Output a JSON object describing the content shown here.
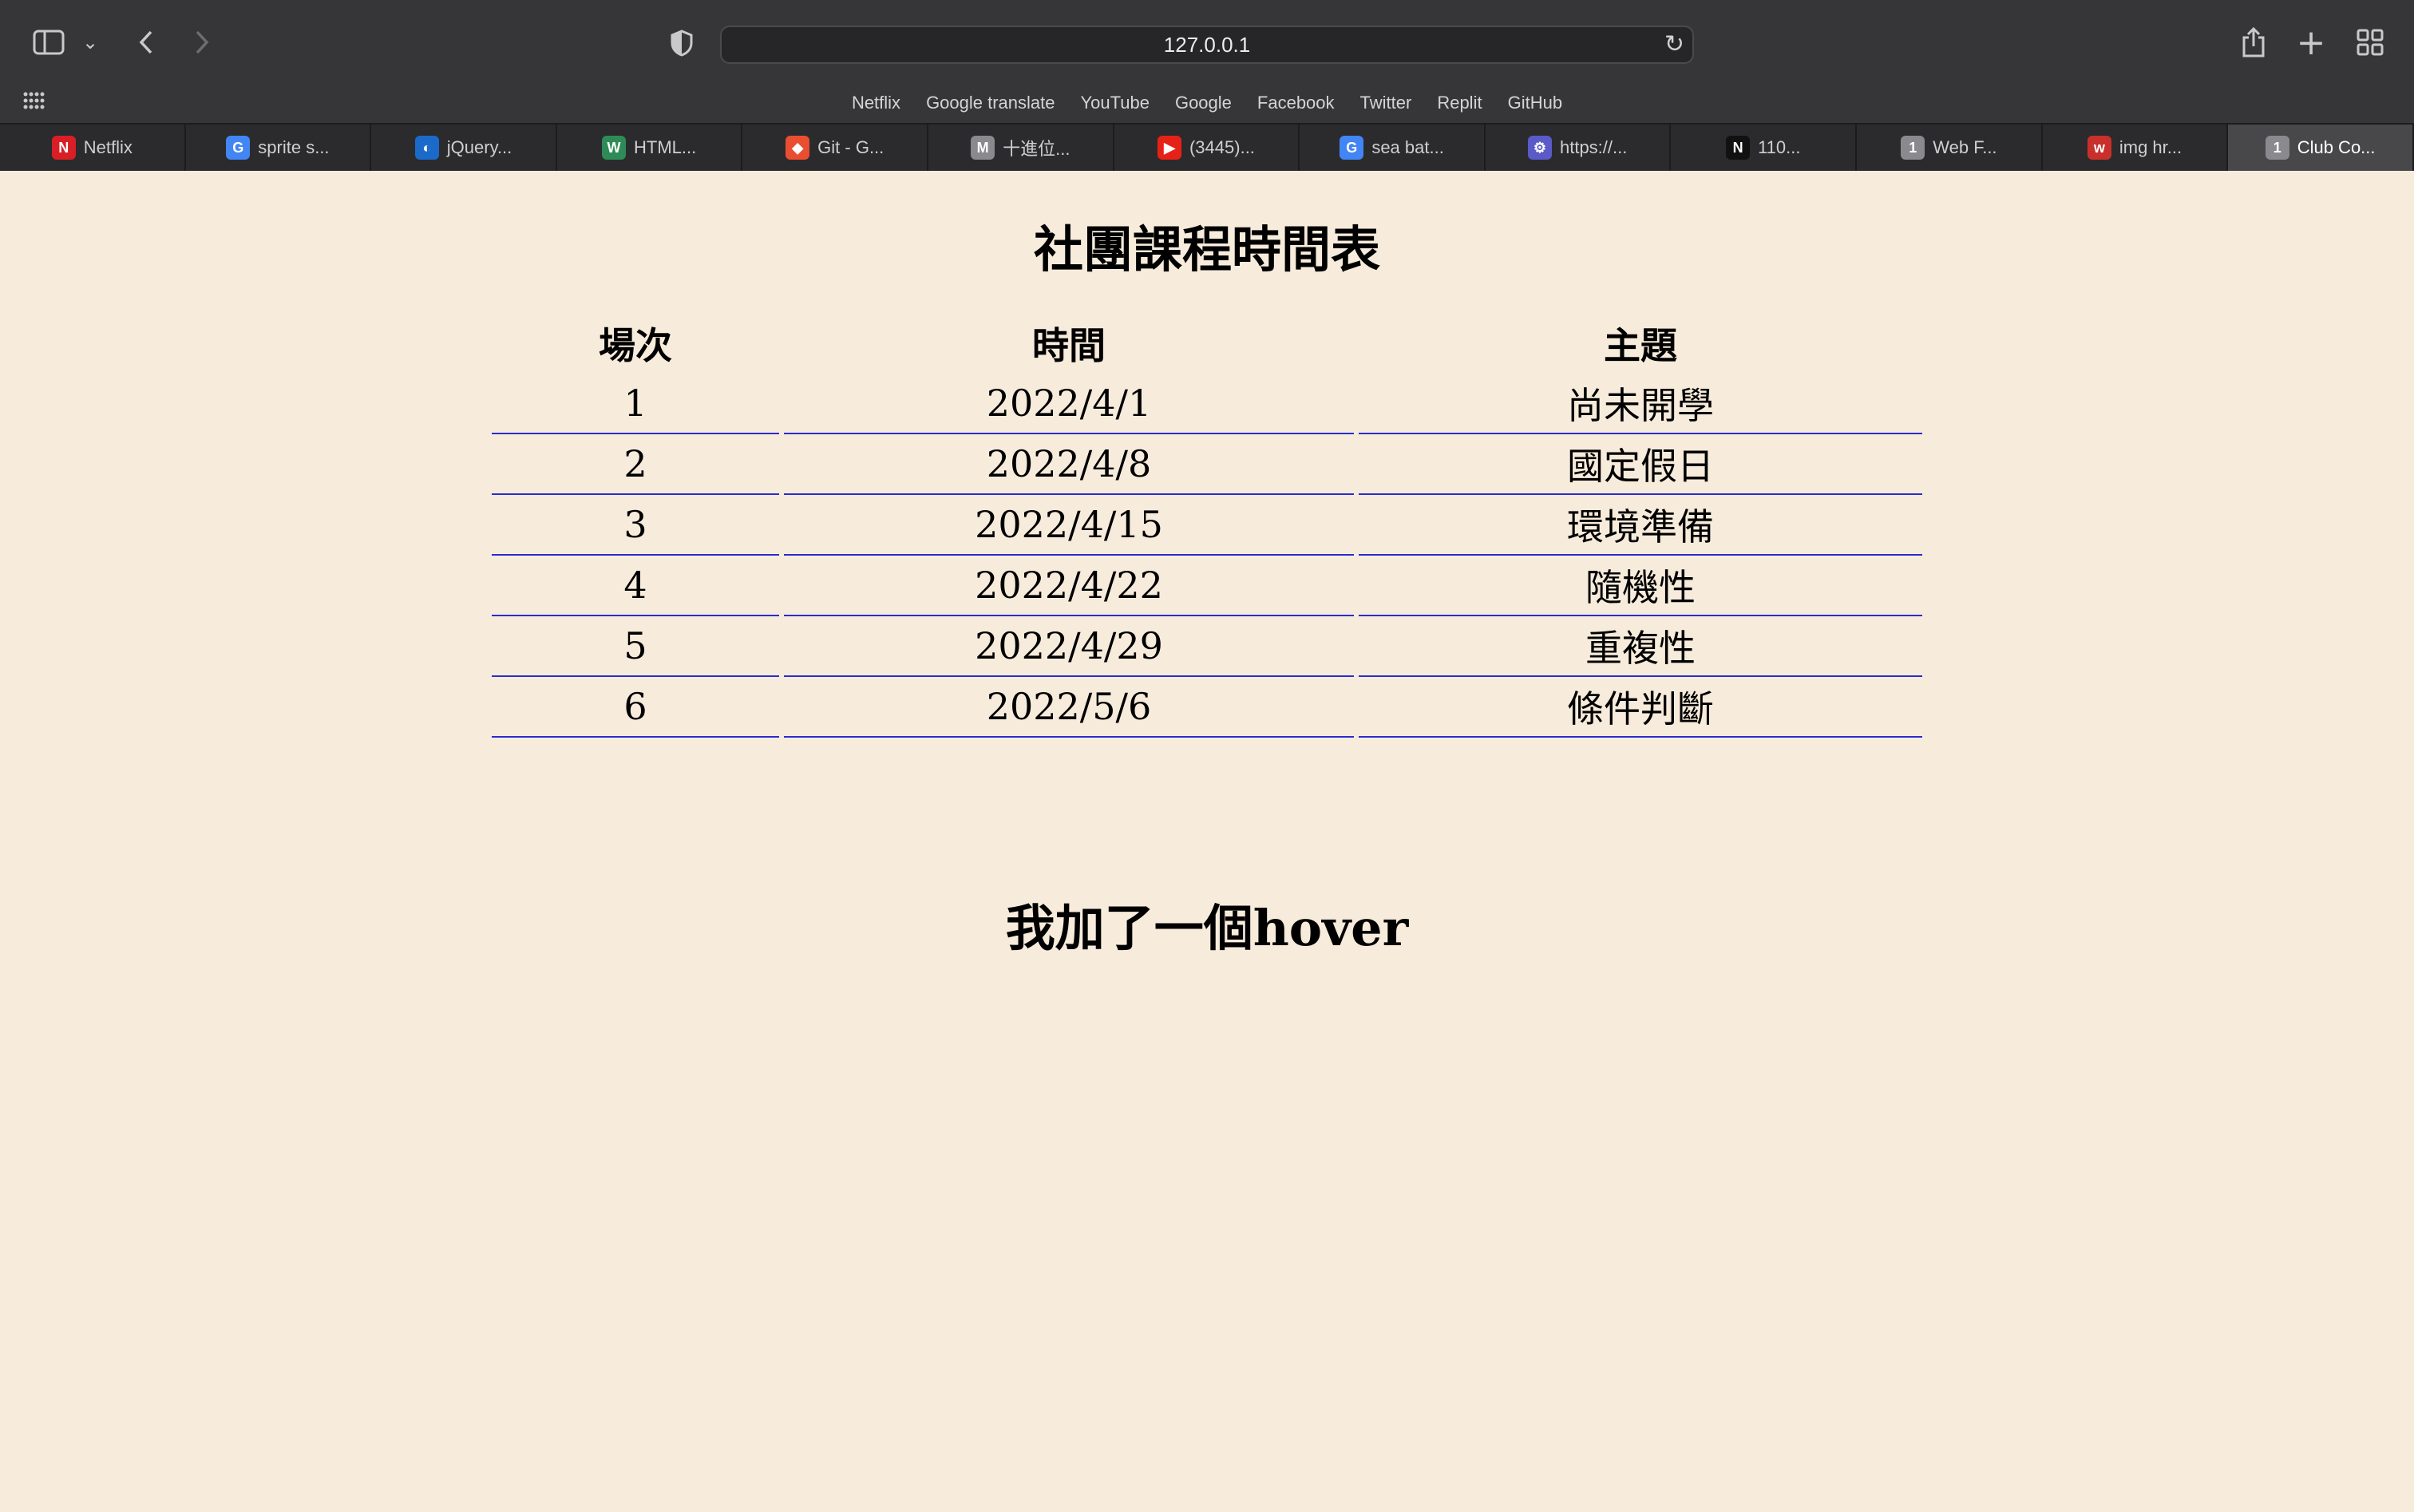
{
  "browser": {
    "url": "127.0.0.1",
    "favorites": [
      "Netflix",
      "Google translate",
      "YouTube",
      "Google",
      "Facebook",
      "Twitter",
      "Replit",
      "GitHub"
    ],
    "tabs": [
      {
        "label": "Netflix",
        "icon": "netflix-icon",
        "glyph": "N",
        "color": "#d81f26"
      },
      {
        "label": "sprite s...",
        "icon": "google-icon",
        "glyph": "G",
        "color": "#4285f4"
      },
      {
        "label": "jQuery...",
        "icon": "jquery-icon",
        "glyph": "◐",
        "color": "#1b6ac9"
      },
      {
        "label": "HTML...",
        "icon": "w3schools-icon",
        "glyph": "W",
        "color": "#2e8b57"
      },
      {
        "label": "Git - G...",
        "icon": "git-icon",
        "glyph": "◆",
        "color": "#e94e31"
      },
      {
        "label": "十進位...",
        "icon": "medium-icon",
        "glyph": "M",
        "color": "#8a8a8e"
      },
      {
        "label": "(3445)...",
        "icon": "youtube-icon",
        "glyph": "▶",
        "color": "#e62117"
      },
      {
        "label": "sea bat...",
        "icon": "google-icon",
        "glyph": "G",
        "color": "#4285f4"
      },
      {
        "label": "https://...",
        "icon": "web-icon",
        "glyph": "⚙",
        "color": "#5a5ac8"
      },
      {
        "label": "110...",
        "icon": "notion-icon",
        "glyph": "N",
        "color": "#111111"
      },
      {
        "label": "Web F...",
        "icon": "numbered-tab-icon",
        "glyph": "1",
        "color": "#8a8a8e"
      },
      {
        "label": "img hr...",
        "icon": "w3-red-icon",
        "glyph": "w",
        "color": "#c9302c"
      },
      {
        "label": "Club Co...",
        "icon": "numbered-tab-icon",
        "glyph": "1",
        "color": "#8a8a8e"
      }
    ],
    "active_tab": 12
  },
  "page": {
    "title": "社團課程時間表",
    "headers": {
      "session": "場次",
      "date": "時間",
      "topic": "主題"
    },
    "rows": [
      {
        "session": "1",
        "date": "2022/4/1",
        "topic": "尚未開學"
      },
      {
        "session": "2",
        "date": "2022/4/8",
        "topic": "國定假日"
      },
      {
        "session": "3",
        "date": "2022/4/15",
        "topic": "環境準備"
      },
      {
        "session": "4",
        "date": "2022/4/22",
        "topic": "隨機性"
      },
      {
        "session": "5",
        "date": "2022/4/29",
        "topic": "重複性"
      },
      {
        "session": "6",
        "date": "2022/5/6",
        "topic": "條件判斷"
      }
    ],
    "note": "我加了一個hover"
  },
  "colors": {
    "page_background": "#f7ebdc",
    "row_border": "#2b2bd0",
    "chrome": "#363638"
  }
}
